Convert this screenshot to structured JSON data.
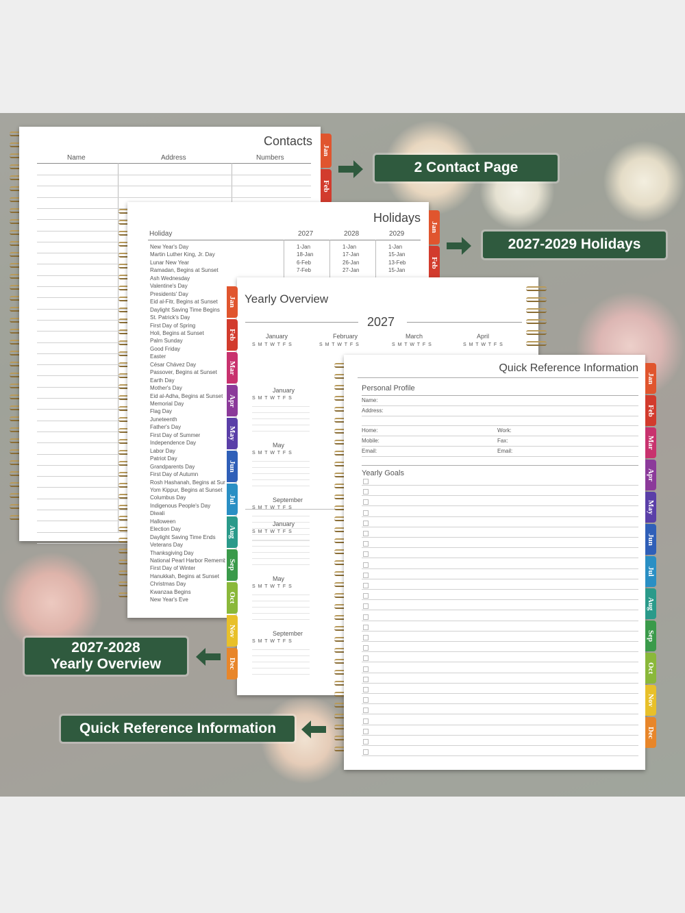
{
  "callouts": {
    "contact": "2 Contact Page",
    "holidays": "2027-2029 Holidays",
    "yearly_line1": "2027-2028",
    "yearly_line2": "Yearly Overview",
    "quick": "Quick Reference Information"
  },
  "contacts": {
    "title": "Contacts",
    "col_name": "Name",
    "col_address": "Address",
    "col_numbers": "Numbers",
    "tabs": [
      "Jan",
      "Feb"
    ]
  },
  "holidays": {
    "title": "Holidays",
    "col_holiday": "Holiday",
    "years": [
      "2027",
      "2028",
      "2029"
    ],
    "tabs": [
      "Jan",
      "Feb"
    ],
    "rows": [
      {
        "name": "New Year's Day",
        "y1": "1-Jan",
        "y2": "1-Jan",
        "y3": "1-Jan"
      },
      {
        "name": "Martin Luther King, Jr. Day",
        "y1": "18-Jan",
        "y2": "17-Jan",
        "y3": "15-Jan"
      },
      {
        "name": "Lunar New Year",
        "y1": "6-Feb",
        "y2": "26-Jan",
        "y3": "13-Feb"
      },
      {
        "name": "Ramadan, Begins at Sunset",
        "y1": "7-Feb",
        "y2": "27-Jan",
        "y3": "15-Jan"
      },
      {
        "name": "Ash Wednesday"
      },
      {
        "name": "Valentine's Day"
      },
      {
        "name": "Presidents' Day"
      },
      {
        "name": "Eid al-Fitr, Begins at Sunset"
      },
      {
        "name": "Daylight Saving Time Begins"
      },
      {
        "name": "St. Patrick's Day"
      },
      {
        "name": "First Day of Spring"
      },
      {
        "name": "Holi, Begins at Sunset"
      },
      {
        "name": "Palm Sunday"
      },
      {
        "name": "Good Friday"
      },
      {
        "name": "Easter"
      },
      {
        "name": "César Chávez Day"
      },
      {
        "name": "Passover, Begins at Sunset"
      },
      {
        "name": "Earth Day"
      },
      {
        "name": "Mother's Day"
      },
      {
        "name": "Eid al-Adha, Begins at Sunset"
      },
      {
        "name": "Memorial Day"
      },
      {
        "name": "Flag Day"
      },
      {
        "name": "Juneteenth"
      },
      {
        "name": "Father's Day"
      },
      {
        "name": "First Day of Summer"
      },
      {
        "name": "Independence Day"
      },
      {
        "name": "Labor Day"
      },
      {
        "name": "Patriot Day"
      },
      {
        "name": "Grandparents Day"
      },
      {
        "name": "First Day of Autumn"
      },
      {
        "name": "Rosh Hashanah, Begins at Sunset"
      },
      {
        "name": "Yom Kippur, Begins at Sunset"
      },
      {
        "name": "Columbus Day"
      },
      {
        "name": "Indigenous People's Day"
      },
      {
        "name": "Diwali"
      },
      {
        "name": "Halloween"
      },
      {
        "name": "Election Day"
      },
      {
        "name": "Daylight Saving Time Ends"
      },
      {
        "name": "Veterans Day"
      },
      {
        "name": "Thanksgiving Day"
      },
      {
        "name": "National Pearl Harbor Remembrance Day"
      },
      {
        "name": "First Day of Winter"
      },
      {
        "name": "Hanukkah, Begins at Sunset"
      },
      {
        "name": "Christmas Day"
      },
      {
        "name": "Kwanzaa Begins"
      },
      {
        "name": "New Year's Eve"
      }
    ]
  },
  "yearly": {
    "title": "Yearly Overview",
    "year": "2027",
    "weekdays": "S M T W T F S",
    "months_top": [
      "January",
      "February",
      "March",
      "April"
    ],
    "months_left": [
      "January",
      "May",
      "September",
      "January",
      "May",
      "September"
    ],
    "tabs": [
      "Jan",
      "Feb",
      "Mar",
      "Apr",
      "May",
      "Jun",
      "Jul",
      "Aug",
      "Sep",
      "Oct",
      "Nov",
      "Dec"
    ]
  },
  "quick_ref": {
    "title": "Quick Reference Information",
    "personal_profile": "Personal Profile",
    "name": "Name:",
    "address": "Address:",
    "home": "Home:",
    "work": "Work:",
    "mobile": "Mobile:",
    "fax": "Fax:",
    "email1": "Email:",
    "email2": "Email:",
    "yearly_goals": "Yearly Goals",
    "tabs": [
      "Jan",
      "Feb",
      "Mar",
      "Apr",
      "May",
      "Jun",
      "Jul",
      "Aug",
      "Sep",
      "Oct",
      "Nov",
      "Dec"
    ]
  },
  "colors": {
    "callout_bg": "#2f5a3e",
    "tab_colors": [
      "#e0552e",
      "#d23b2d",
      "#c8326e",
      "#8b3a9a",
      "#5a3fa8",
      "#2f5fb8",
      "#2a8fc4",
      "#2a9a8a",
      "#3a9a4a",
      "#8ab83a",
      "#e8c02a",
      "#e8862a"
    ]
  }
}
